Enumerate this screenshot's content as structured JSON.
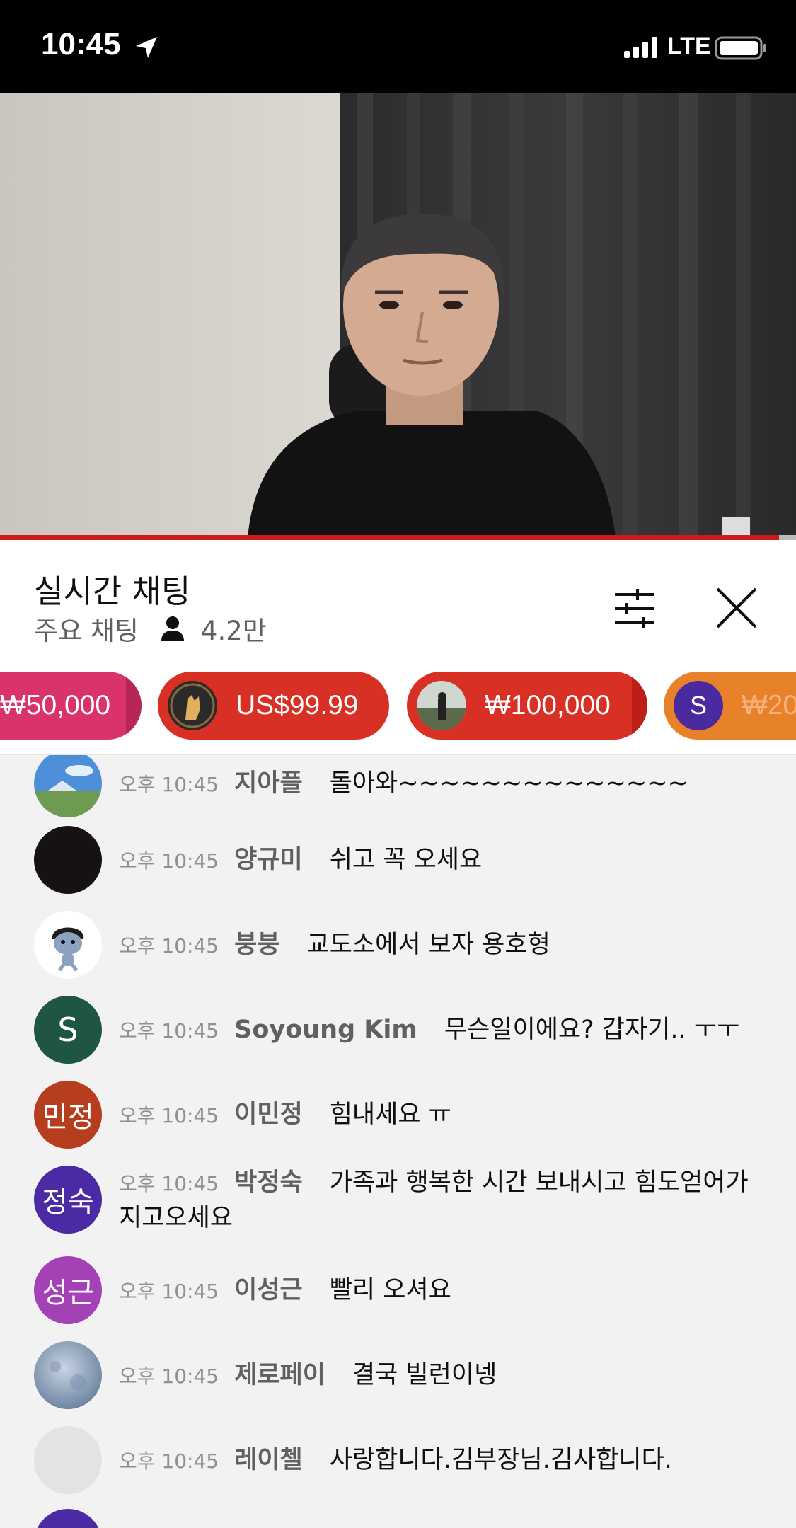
{
  "status_bar": {
    "time": "10:45",
    "network": "LTE"
  },
  "chat_header": {
    "title": "실시간 채팅",
    "mode": "주요 채팅",
    "viewer_count": "4.2만"
  },
  "super_chats": [
    {
      "amount": "₩50,000",
      "color": "#d9336a"
    },
    {
      "amount": "US$99.99",
      "color": "#d93025"
    },
    {
      "amount": "₩100,000",
      "color": "#d93025"
    },
    {
      "amount": "₩20",
      "avatar_letter": "S",
      "color": "#e8822a"
    }
  ],
  "messages": [
    {
      "time": "오후 10:45",
      "author": "지아플",
      "text": "돌아와~~~~~~~~~~~~~~"
    },
    {
      "time": "오후 10:45",
      "author": "양규미",
      "text": "쉬고 꼭 오세요"
    },
    {
      "time": "오후 10:45",
      "author": "붕붕",
      "text": "교도소에서 보자 용호형"
    },
    {
      "time": "오후 10:45",
      "author": "Soyoung Kim",
      "text": "무슨일이에요? 갑자기.. ㅜㅜ",
      "avatar_letter": "S"
    },
    {
      "time": "오후 10:45",
      "author": "이민정",
      "text": "힘내세요 ㅠ",
      "avatar_letter": "민정"
    },
    {
      "time": "오후 10:45",
      "author": "박정숙",
      "text": "가족과 행복한 시간 보내시고 힘도얻어가지고오세요",
      "avatar_letter": "정숙"
    },
    {
      "time": "오후 10:45",
      "author": "이성근",
      "text": "빨리 오셔요",
      "avatar_letter": "성근"
    },
    {
      "time": "오후 10:45",
      "author": "제로페이",
      "text": "결국 빌런이넹"
    },
    {
      "time": "오후 10:45",
      "author": "레이첼",
      "text": "사랑합니다.김부장님.김사합니다."
    }
  ]
}
